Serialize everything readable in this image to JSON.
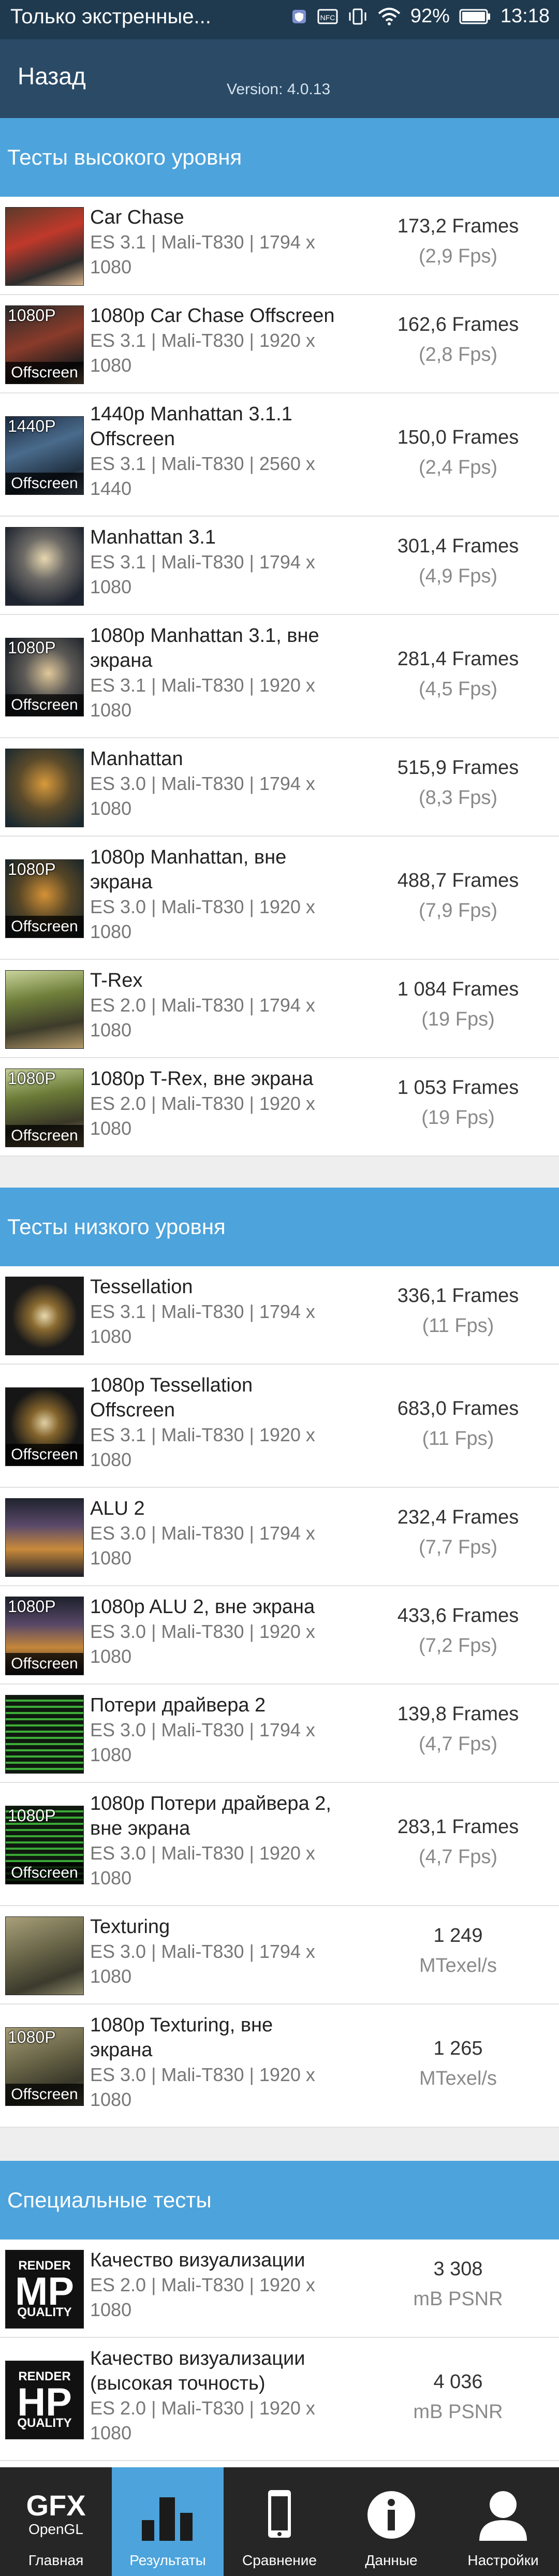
{
  "status_bar": {
    "carrier_text": "Только экстренные...",
    "battery": "92%",
    "time": "13:18",
    "icons": [
      "shield-icon",
      "nfc-icon",
      "vibrate-icon",
      "wifi-icon",
      "battery-icon"
    ]
  },
  "app_bar": {
    "back_label": "Назад",
    "version": "Version: 4.0.13"
  },
  "sections": [
    {
      "title": "Тесты высокого уровня",
      "rows": [
        {
          "title1": "Car Chase",
          "title2": "",
          "detail1": "ES 3.1 | Mali-T830 | 1794 x",
          "detail2": "1080",
          "value": "173,2 Frames",
          "unit": "(2,9 Fps)",
          "badge": "",
          "offscreen": ""
        },
        {
          "title1": "1080p Car Chase Offscreen",
          "title2": "",
          "detail1": "ES 3.1 | Mali-T830 | 1920 x",
          "detail2": "1080",
          "value": "162,6 Frames",
          "unit": "(2,8 Fps)",
          "badge": "1080P",
          "offscreen": "Offscreen"
        },
        {
          "title1": "1440p Manhattan 3.1.1",
          "title2": "Offscreen",
          "detail1": "ES 3.1 | Mali-T830 | 2560 x",
          "detail2": "1440",
          "value": "150,0 Frames",
          "unit": "(2,4 Fps)",
          "badge": "1440P",
          "offscreen": "Offscreen"
        },
        {
          "title1": "Manhattan 3.1",
          "title2": "",
          "detail1": "ES 3.1 | Mali-T830 | 1794 x",
          "detail2": "1080",
          "value": "301,4 Frames",
          "unit": "(4,9 Fps)",
          "badge": "",
          "offscreen": ""
        },
        {
          "title1": "1080p Manhattan 3.1, вне",
          "title2": "экрана",
          "detail1": "ES 3.1 | Mali-T830 | 1920 x",
          "detail2": "1080",
          "value": "281,4 Frames",
          "unit": "(4,5 Fps)",
          "badge": "1080P",
          "offscreen": "Offscreen"
        },
        {
          "title1": "Manhattan",
          "title2": "",
          "detail1": "ES 3.0 | Mali-T830 | 1794 x",
          "detail2": "1080",
          "value": "515,9 Frames",
          "unit": "(8,3 Fps)",
          "badge": "",
          "offscreen": ""
        },
        {
          "title1": "1080p Manhattan, вне",
          "title2": "экрана",
          "detail1": "ES 3.0 | Mali-T830 | 1920 x",
          "detail2": "1080",
          "value": "488,7 Frames",
          "unit": "(7,9 Fps)",
          "badge": "1080P",
          "offscreen": "Offscreen"
        },
        {
          "title1": "T-Rex",
          "title2": "",
          "detail1": "ES 2.0 | Mali-T830 | 1794 x",
          "detail2": "1080",
          "value": "1 084 Frames",
          "unit": "(19 Fps)",
          "badge": "",
          "offscreen": ""
        },
        {
          "title1": "1080p T-Rex, вне экрана",
          "title2": "",
          "detail1": "ES 2.0 | Mali-T830 | 1920 x",
          "detail2": "1080",
          "value": "1 053 Frames",
          "unit": "(19 Fps)",
          "badge": "1080P",
          "offscreen": "Offscreen"
        }
      ]
    },
    {
      "title": "Тесты низкого уровня",
      "rows": [
        {
          "title1": "Tessellation",
          "title2": "",
          "detail1": "ES 3.1 | Mali-T830 | 1794 x",
          "detail2": "1080",
          "value": "336,1 Frames",
          "unit": "(11 Fps)",
          "badge": "",
          "offscreen": ""
        },
        {
          "title1": "1080p Tessellation",
          "title2": "Offscreen",
          "detail1": "ES 3.1 | Mali-T830 | 1920 x",
          "detail2": "1080",
          "value": "683,0 Frames",
          "unit": "(11 Fps)",
          "badge": "",
          "offscreen": "Offscreen"
        },
        {
          "title1": "ALU 2",
          "title2": "",
          "detail1": "ES 3.0 | Mali-T830 | 1794 x",
          "detail2": "1080",
          "value": "232,4 Frames",
          "unit": "(7,7 Fps)",
          "badge": "",
          "offscreen": ""
        },
        {
          "title1": "1080p ALU 2, вне экрана",
          "title2": "",
          "detail1": "ES 3.0 | Mali-T830 | 1920 x",
          "detail2": "1080",
          "value": "433,6 Frames",
          "unit": "(7,2 Fps)",
          "badge": "1080P",
          "offscreen": "Offscreen"
        },
        {
          "title1": "Потери драйвера 2",
          "title2": "",
          "detail1": "ES 3.0 | Mali-T830 | 1794 x",
          "detail2": "1080",
          "value": "139,8 Frames",
          "unit": "(4,7 Fps)",
          "badge": "",
          "offscreen": ""
        },
        {
          "title1": "1080p Потери драйвера 2,",
          "title2": "вне экрана",
          "detail1": "ES 3.0 | Mali-T830 | 1920 x",
          "detail2": "1080",
          "value": "283,1 Frames",
          "unit": "(4,7 Fps)",
          "badge": "1080P",
          "offscreen": "Offscreen"
        },
        {
          "title1": "Texturing",
          "title2": "",
          "detail1": "ES 3.0 | Mali-T830 | 1794 x",
          "detail2": "1080",
          "value": "1 249",
          "unit": "MTexel/s",
          "badge": "",
          "offscreen": ""
        },
        {
          "title1": "1080p Texturing, вне",
          "title2": "экрана",
          "detail1": "ES 3.0 | Mali-T830 | 1920 x",
          "detail2": "1080",
          "value": "1 265",
          "unit": "MTexel/s",
          "badge": "1080P",
          "offscreen": "Offscreen"
        }
      ]
    },
    {
      "title": "Специальные тесты",
      "rows": [
        {
          "title1": "Качество визуализации",
          "title2": "",
          "detail1": "ES 2.0 | Mali-T830 | 1920 x",
          "detail2": "1080",
          "value": "3 308",
          "unit": "mB PSNR",
          "badge_top": "RENDER",
          "badge_big": "MP",
          "badge_bot": "QUALITY"
        },
        {
          "title1": "Качество визуализации",
          "title2": "(высокая точность)",
          "detail1": "ES 2.0 | Mali-T830 | 1920 x",
          "detail2": "1080",
          "value": "4 036",
          "unit": "mB PSNR",
          "badge_top": "RENDER",
          "badge_big": "HP",
          "badge_bot": "QUALITY"
        }
      ]
    }
  ],
  "nav": {
    "items": [
      {
        "label": "Главная",
        "logo_big": "GFX",
        "logo_small": "OpenGL",
        "icon": "gfx-logo-icon"
      },
      {
        "label": "Результаты",
        "icon": "bar-chart-icon"
      },
      {
        "label": "Сравнение",
        "icon": "phone-icon"
      },
      {
        "label": "Данные",
        "icon": "info-icon"
      },
      {
        "label": "Настройки",
        "icon": "person-icon"
      }
    ]
  }
}
